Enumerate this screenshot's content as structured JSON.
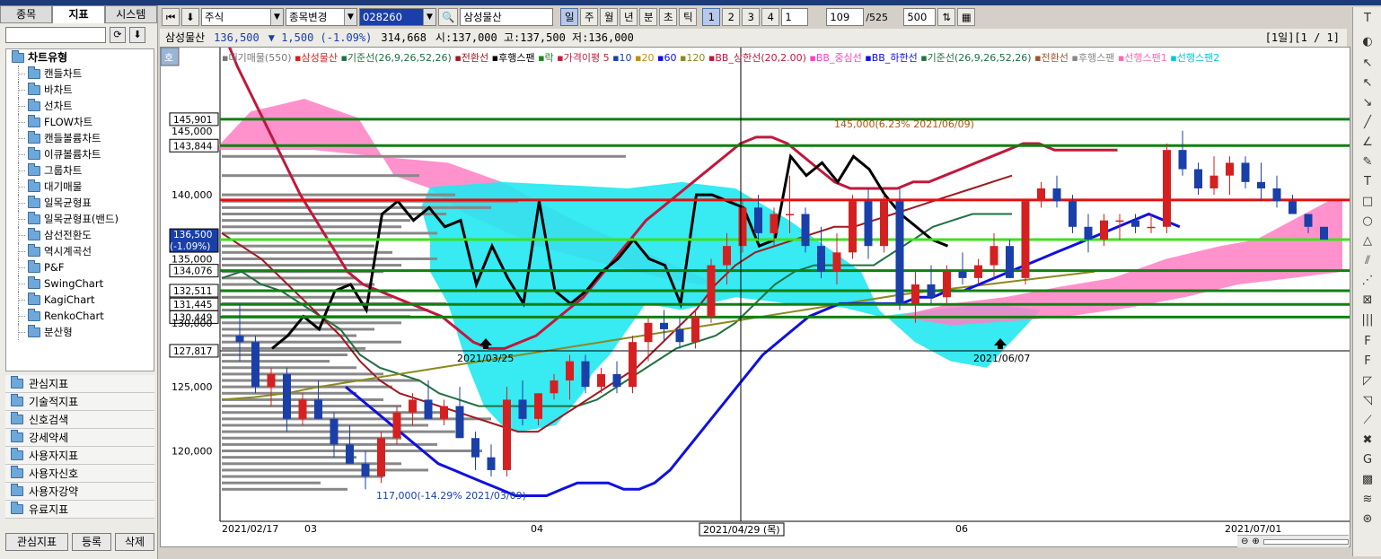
{
  "left_panel": {
    "tabs": [
      "종목",
      "지표",
      "시스템"
    ],
    "active_tab": "지표",
    "refresh_icon": "refresh-icon",
    "download_icon": "download-icon",
    "tree_root": "차트유형",
    "tree_items": [
      "캔들차트",
      "바차트",
      "선차트",
      "FLOW차트",
      "캔들볼륨차트",
      "이큐볼륨차트",
      "그룹차트",
      "대기매물",
      "일목균형표",
      "일목균형표(밴드)",
      "삼선전환도",
      "역시계곡선",
      "P&F",
      "SwingChart",
      "KagiChart",
      "RenkoChart",
      "분산형"
    ],
    "categories": [
      "관심지표",
      "기술적지표",
      "신호검색",
      "강세약세",
      "사용자지표",
      "사용자신호",
      "사용자강약",
      "유료지표"
    ],
    "bottom_buttons": [
      "관심지표",
      "등록",
      "삭제"
    ]
  },
  "toolbar": {
    "market_type": "주식",
    "change_button": "종목변경",
    "stock_code": "028260",
    "stock_name": "삼성물산",
    "periods": [
      "일",
      "주",
      "월",
      "년",
      "분",
      "초",
      "틱"
    ],
    "active_period": "일",
    "intervals": [
      "1",
      "2",
      "3",
      "4"
    ],
    "interval_value": "1",
    "count_value": "109",
    "count_total": "/525",
    "display_count": "500"
  },
  "infobar": {
    "name": "삼성물산",
    "price": "136,500",
    "change": "▼ 1,500 (-1.09%)",
    "volume": "314,668",
    "ohlc": "시:137,000 고:137,500 저:136,000",
    "page": "[1일][1 / 1]"
  },
  "colors": {
    "up": "#d42020",
    "down": "#1a3fa8",
    "bb_upper": "#c0183c",
    "bb_lower": "#1010e0",
    "cloud_pink": "#ff7fc4",
    "cloud_cyan": "#22e8f0",
    "lagging": "#000000",
    "hline_green": "#108010",
    "hline_red": "#e01010",
    "hline_lime": "#40e020"
  },
  "chart_data": {
    "type": "candlestick",
    "legend": [
      "대기매물(550)",
      "삼성물산",
      "기준선(26,9,26,52,26)",
      "전환선",
      "후행스팬",
      "락",
      "가격이평 5",
      "10",
      "20",
      "60",
      "120",
      "BB_상한선(20,2.00)",
      "BB_중심선",
      "BB_하한선",
      "기준선(26,9,26,52,26)",
      "전환선",
      "후행스팬",
      "선행스팬1",
      "선행스팬2"
    ],
    "y_ticks": [
      145000,
      140000,
      135000,
      130000,
      125000,
      120000
    ],
    "y_tick_labels": [
      "145,000",
      "140,000",
      "135,000",
      "130,000",
      "125,000",
      "120,000"
    ],
    "ylim": [
      114500,
      151500
    ],
    "x_labels": [
      "2021/02/17",
      "03",
      "04",
      "06",
      "2021/07/01"
    ],
    "crosshair_label": "2021/04/29 (목)",
    "hlines": [
      {
        "value": 145901,
        "label": "145,901",
        "color": "green"
      },
      {
        "value": 143844,
        "label": "143,844",
        "color": "green"
      },
      {
        "value": 139600,
        "label": "",
        "color": "red"
      },
      {
        "value": 136500,
        "label": "136,500",
        "sub": "(-1.09%)",
        "color": "lime"
      },
      {
        "value": 134076,
        "label": "134,076",
        "color": "green"
      },
      {
        "value": 132511,
        "label": "132,511",
        "color": "green"
      },
      {
        "value": 131445,
        "label": "131,445",
        "color": "green"
      },
      {
        "value": 130449,
        "label": "130,449",
        "color": "green"
      },
      {
        "value": 127817,
        "label": "127,817",
        "color": "black"
      }
    ],
    "annotations": [
      {
        "text": "117,000(-14.29% 2021/03/09)",
        "value": 117000
      },
      {
        "text": "145,000(6.23% 2021/06/09)",
        "value": 145000
      },
      {
        "text": "2021/03/25",
        "value": 126000
      },
      {
        "text": "2021/06/07",
        "value": 126000
      }
    ],
    "candles": [
      [
        129000,
        131500,
        127000,
        128500
      ],
      [
        128500,
        129000,
        124500,
        125000
      ],
      [
        125000,
        126500,
        123500,
        126000
      ],
      [
        126000,
        126500,
        121500,
        122500
      ],
      [
        122500,
        124500,
        122000,
        124000
      ],
      [
        124000,
        125500,
        123000,
        122500
      ],
      [
        122500,
        123000,
        119500,
        120500
      ],
      [
        120500,
        122000,
        119000,
        119000
      ],
      [
        119000,
        120000,
        117000,
        118000
      ],
      [
        118000,
        121500,
        117500,
        121000
      ],
      [
        121000,
        123500,
        120500,
        123000
      ],
      [
        123000,
        124500,
        122000,
        124000
      ],
      [
        124000,
        125500,
        122500,
        122500
      ],
      [
        122500,
        124000,
        122000,
        123500
      ],
      [
        123500,
        125000,
        121000,
        121000
      ],
      [
        121000,
        121500,
        118500,
        119500
      ],
      [
        119500,
        120500,
        118000,
        118500
      ],
      [
        118500,
        125000,
        118000,
        124000
      ],
      [
        124000,
        125500,
        122000,
        122500
      ],
      [
        122500,
        124500,
        122000,
        124500
      ],
      [
        124500,
        126000,
        124000,
        125500
      ],
      [
        125500,
        127500,
        124000,
        127000
      ],
      [
        127000,
        127500,
        124500,
        125000
      ],
      [
        125000,
        126500,
        124500,
        126000
      ],
      [
        126000,
        127000,
        124500,
        125000
      ],
      [
        125000,
        129000,
        124500,
        128500
      ],
      [
        128500,
        130500,
        127000,
        130000
      ],
      [
        130000,
        131000,
        128500,
        129500
      ],
      [
        129500,
        130500,
        128000,
        128500
      ],
      [
        128500,
        131000,
        128000,
        130500
      ],
      [
        130500,
        135000,
        130000,
        134500
      ],
      [
        134500,
        137000,
        133000,
        136000
      ],
      [
        136000,
        139500,
        135500,
        139000
      ],
      [
        139000,
        140000,
        136500,
        137000
      ],
      [
        137000,
        139000,
        136000,
        138500
      ],
      [
        138500,
        141500,
        137000,
        138500
      ],
      [
        138500,
        139000,
        135500,
        136000
      ],
      [
        136000,
        137500,
        133500,
        134000
      ],
      [
        134000,
        137000,
        133000,
        135500
      ],
      [
        135500,
        140000,
        135000,
        139500
      ],
      [
        139500,
        140500,
        135000,
        136000
      ],
      [
        136000,
        140000,
        135500,
        139500
      ],
      [
        139500,
        140500,
        131000,
        131500
      ],
      [
        131500,
        134000,
        130000,
        133000
      ],
      [
        133000,
        134500,
        131500,
        132000
      ],
      [
        132000,
        134500,
        131500,
        134000
      ],
      [
        134000,
        135500,
        133000,
        133500
      ],
      [
        133500,
        135000,
        133000,
        134500
      ],
      [
        134500,
        137000,
        133500,
        136000
      ],
      [
        136000,
        136500,
        133500,
        133500
      ],
      [
        133500,
        139500,
        133000,
        139500
      ],
      [
        139500,
        141000,
        139000,
        140500
      ],
      [
        140500,
        141500,
        139000,
        139500
      ],
      [
        139500,
        140000,
        137000,
        137500
      ],
      [
        137500,
        138500,
        135500,
        136500
      ],
      [
        136500,
        138500,
        136000,
        138000
      ],
      [
        138000,
        138500,
        136500,
        138000
      ],
      [
        138000,
        138500,
        137000,
        137500
      ],
      [
        137500,
        138500,
        137000,
        137500
      ],
      [
        137500,
        144000,
        137000,
        143500
      ],
      [
        143500,
        145000,
        141500,
        142000
      ],
      [
        142000,
        142500,
        140000,
        140500
      ],
      [
        140500,
        143000,
        140000,
        141500
      ],
      [
        141500,
        143000,
        140000,
        142500
      ],
      [
        142500,
        143000,
        140500,
        141000
      ],
      [
        141000,
        142500,
        139500,
        140500
      ],
      [
        140500,
        141500,
        139000,
        139500
      ],
      [
        139500,
        140000,
        138500,
        138500
      ],
      [
        138500,
        138500,
        137000,
        137500
      ],
      [
        137500,
        137500,
        136500,
        136500
      ]
    ],
    "bb_upper": [
      153000,
      150000,
      147500,
      145000,
      142500,
      140000,
      138000,
      136000,
      134000,
      133000,
      132500,
      132000,
      131500,
      131000,
      130500,
      129500,
      128500,
      128000,
      128000,
      128500,
      129000,
      130000,
      131000,
      132000,
      133500,
      135000,
      136500,
      138000,
      139000,
      140000,
      141000,
      142000,
      143000,
      144000,
      144500,
      144500,
      144000,
      143000,
      142000,
      141000,
      140500,
      140500,
      140500,
      140500,
      141000,
      141000,
      141500,
      142000,
      142500,
      143000,
      143500,
      144000,
      144000,
      143500,
      143500,
      143500,
      143500,
      143500
    ],
    "bb_lower": [
      125000,
      124000,
      123000,
      122000,
      121000,
      120000,
      119000,
      118500,
      118000,
      117500,
      117000,
      116500,
      116500,
      116500,
      117000,
      117500,
      117500,
      117500,
      117000,
      117000,
      117500,
      118500,
      120000,
      121500,
      123000,
      124500,
      126000,
      127500,
      128500,
      129500,
      130500,
      131000,
      131500,
      131500,
      131500,
      131500,
      131500,
      132000,
      132000,
      132500,
      132500,
      133000,
      133500,
      134000,
      134500,
      135000,
      135500,
      136000,
      136500,
      137000,
      137500,
      138000,
      138500,
      138000,
      137500
    ],
    "lagging": [
      128000,
      129000,
      130500,
      129500,
      132500,
      133000,
      131000,
      138500,
      139500,
      138000,
      139000,
      137500,
      138000,
      133000,
      136000,
      133500,
      131500,
      139500,
      132500,
      131500,
      132500,
      134000,
      135000,
      136500,
      135000,
      134500,
      131500,
      140000,
      140000,
      139500,
      139000,
      136000,
      136500,
      143000,
      141500,
      142500,
      141000,
      143000,
      142000,
      140000,
      138500,
      137500,
      136500,
      136000
    ]
  }
}
